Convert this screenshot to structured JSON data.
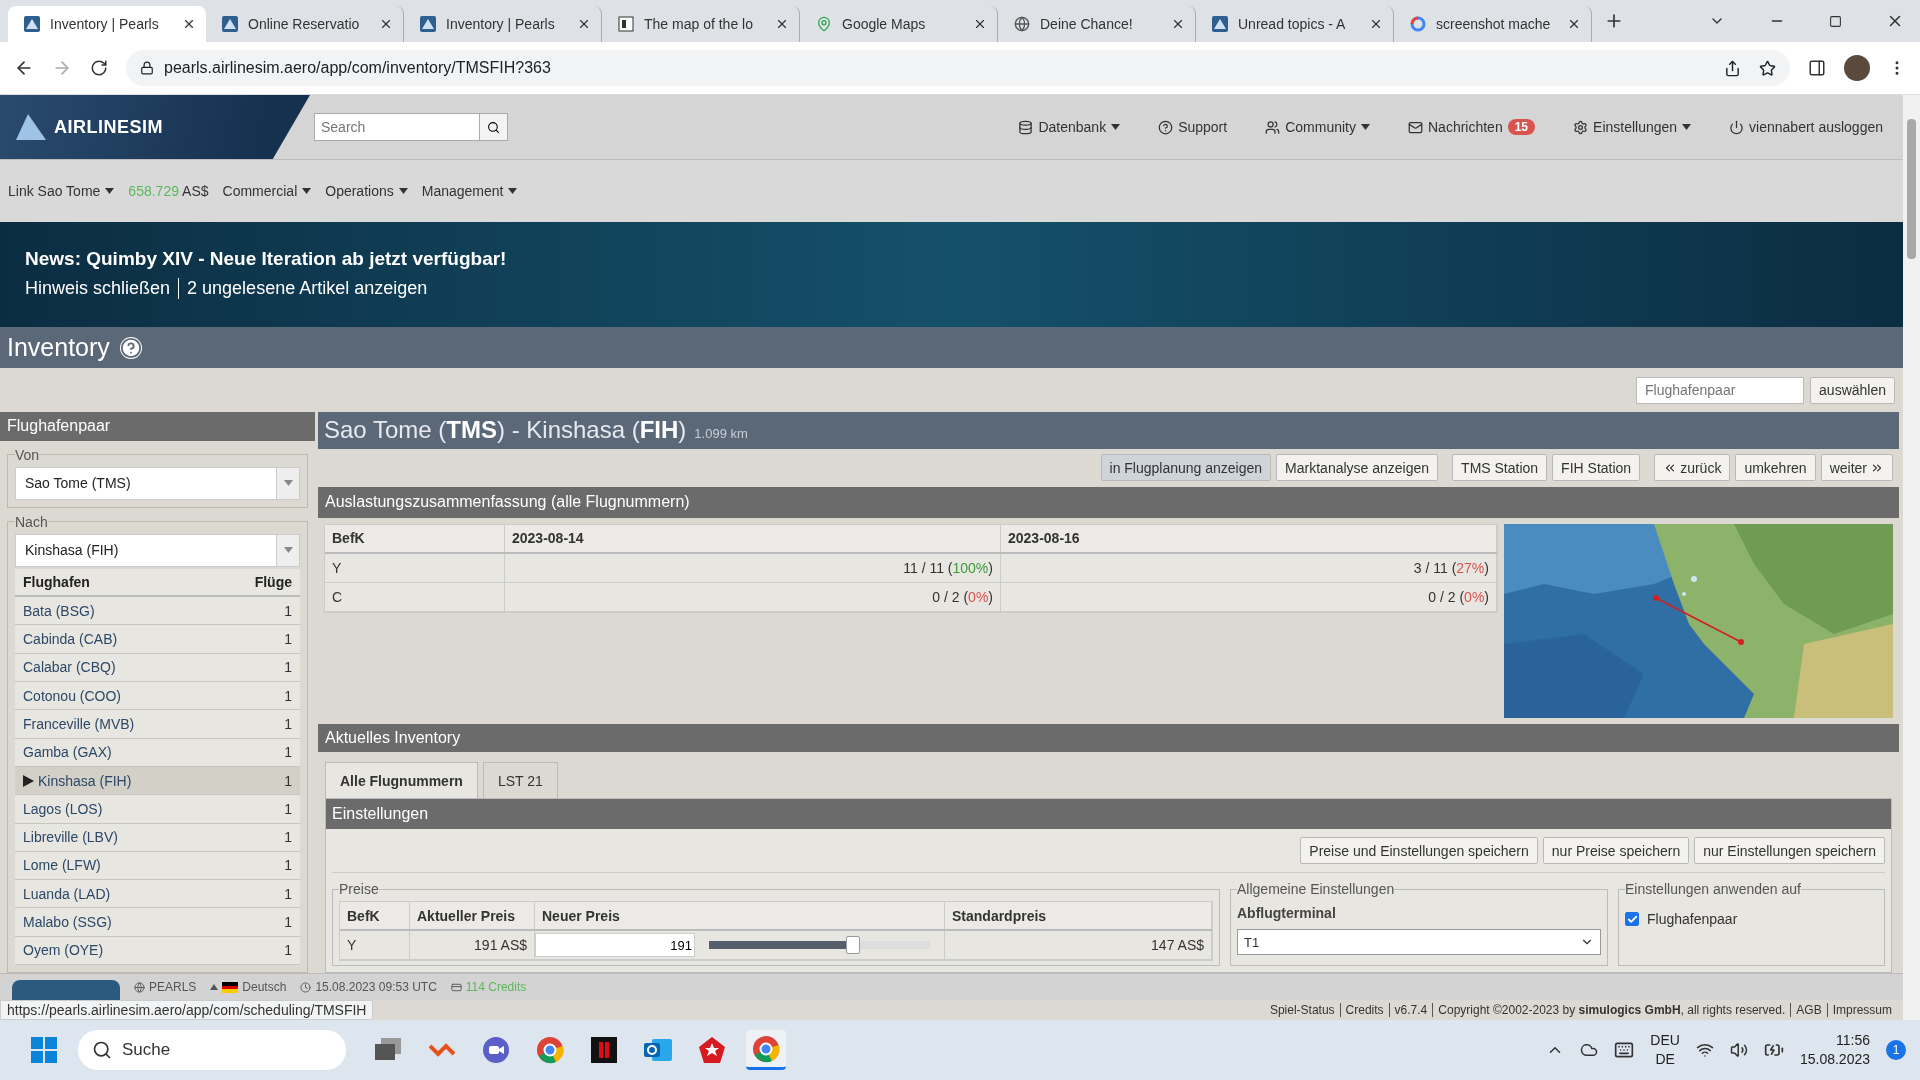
{
  "browser": {
    "tabs": [
      {
        "title": "Inventory | Pearls",
        "selected": true
      },
      {
        "title": "Online Reservatio",
        "selected": false
      },
      {
        "title": "Inventory | Pearls",
        "selected": false
      },
      {
        "title": "The map of the lo",
        "selected": false
      },
      {
        "title": "Google Maps",
        "selected": false
      },
      {
        "title": "Deine Chance!",
        "selected": false
      },
      {
        "title": "Unread topics - A",
        "selected": false
      },
      {
        "title": "screenshot mache",
        "selected": false
      }
    ],
    "address": "pearls.airlinesim.aero/app/com/inventory/TMSFIH?363"
  },
  "header": {
    "logo": "AIRLINESIM",
    "search": {
      "placeholder": "Search"
    },
    "menu": [
      {
        "label": "Datenbank",
        "kind": "dropdown"
      },
      {
        "label": "Support",
        "kind": "link"
      },
      {
        "label": "Community",
        "kind": "dropdown"
      },
      {
        "label": "Nachrichten",
        "kind": "badge",
        "badge": "15"
      },
      {
        "label": "Einstellungen",
        "kind": "dropdown"
      },
      {
        "label": "viennabert ausloggen",
        "kind": "link"
      }
    ]
  },
  "nav": [
    {
      "label": "Link Sao Tome",
      "kind": "dropdown"
    },
    {
      "label": "658.729",
      "unit": "AS$",
      "kind": "balance"
    },
    {
      "label": "Commercial",
      "kind": "dropdown"
    },
    {
      "label": "Operations",
      "kind": "dropdown"
    },
    {
      "label": "Management",
      "kind": "dropdown"
    }
  ],
  "news": {
    "title": "News: Quimby XIV - Neue Iteration ab jetzt verfügbar!",
    "links": [
      "Hinweis schließen",
      "2 ungelesene Artikel anzeigen"
    ]
  },
  "page_title": "Inventory",
  "filter": {
    "placeholder": "Flughafenpaar",
    "button": "auswählen"
  },
  "sidebar": {
    "title": "Flughafenpaar",
    "from": {
      "legend": "Von",
      "value": "Sao Tome (TMS)"
    },
    "to": {
      "legend": "Nach",
      "value": "Kinshasa (FIH)"
    },
    "columns": [
      "Flughafen",
      "Flüge"
    ],
    "rows": [
      {
        "airport": "Bata (BSG)",
        "flights": "1",
        "selected": false
      },
      {
        "airport": "Cabinda (CAB)",
        "flights": "1",
        "selected": false
      },
      {
        "airport": "Calabar (CBQ)",
        "flights": "1",
        "selected": false
      },
      {
        "airport": "Cotonou (COO)",
        "flights": "1",
        "selected": false
      },
      {
        "airport": "Franceville (MVB)",
        "flights": "1",
        "selected": false
      },
      {
        "airport": "Gamba (GAX)",
        "flights": "1",
        "selected": false
      },
      {
        "airport": "Kinshasa (FIH)",
        "flights": "1",
        "selected": true
      },
      {
        "airport": "Lagos (LOS)",
        "flights": "1",
        "selected": false
      },
      {
        "airport": "Libreville (LBV)",
        "flights": "1",
        "selected": false
      },
      {
        "airport": "Lome (LFW)",
        "flights": "1",
        "selected": false
      },
      {
        "airport": "Luanda (LAD)",
        "flights": "1",
        "selected": false
      },
      {
        "airport": "Malabo (SSG)",
        "flights": "1",
        "selected": false
      },
      {
        "airport": "Oyem (OYE)",
        "flights": "1",
        "selected": false
      }
    ]
  },
  "route": {
    "title": "Sao Tome (**TMS**) - Kinshasa (**FIH**)",
    "distance": "1.099 km",
    "actions": [
      [
        {
          "label": "in Flugplanung anzeigen",
          "kind": "plain",
          "pressed": true
        },
        {
          "label": "Marktanalyse anzeigen",
          "kind": "plain",
          "pressed": false
        }
      ],
      [
        {
          "label": "TMS Station",
          "kind": "plain",
          "pressed": false
        },
        {
          "label": "FIH Station",
          "kind": "plain",
          "pressed": false
        }
      ],
      [
        {
          "label": "zurück",
          "kind": "prev",
          "pressed": false
        },
        {
          "label": "umkehren",
          "kind": "plain",
          "pressed": false
        },
        {
          "label": "weiter",
          "kind": "next",
          "pressed": false
        }
      ]
    ]
  },
  "summary": {
    "title": "Auslastungszusammenfassung (alle Flugnummern)",
    "columns": [
      "BefK",
      "2023-08-14",
      "2023-08-16"
    ],
    "rows": [
      {
        "class": "Y",
        "cells": [
          {
            "value": "11 / 11 (",
            "pct": "100%",
            "close": ")",
            "color": "#3c9a3c"
          },
          {
            "value": "3 / 11 (",
            "pct": "27%",
            "close": ")",
            "color": "#d9534f"
          }
        ]
      },
      {
        "class": "C",
        "cells": [
          {
            "value": "0 / 2 (",
            "pct": "0%",
            "close": ")",
            "color": "#d9534f"
          },
          {
            "value": "0 / 2 (",
            "pct": "0%",
            "close": ")",
            "color": "#d9534f"
          }
        ]
      }
    ]
  },
  "inventory": {
    "title": "Aktuelles Inventory",
    "tabs": [
      {
        "label": "Alle Flugnummern",
        "selected": true
      },
      {
        "label": "LST 21",
        "selected": false
      }
    ],
    "settings": {
      "title": "Einstellungen",
      "buttons": [
        "Preise und Einstellungen speichern",
        "nur Preise speichern",
        "nur Einstellungen speichern"
      ],
      "prices": {
        "legend": "Preise",
        "columns": [
          "BefK",
          "Aktueller Preis",
          "Neuer Preis",
          "Standardpreis"
        ],
        "rows": [
          {
            "class": "Y",
            "current": "191 AS$",
            "new": "191",
            "level": 0.65,
            "standard": "147 AS$"
          }
        ]
      },
      "general": {
        "legend": "Allgemeine Einstellungen",
        "label": "Abflugterminal",
        "value": "T1"
      },
      "apply": {
        "legend": "Einstellungen anwenden auf",
        "options": [
          {
            "label": "Flughafenpaar",
            "checked": true
          }
        ]
      }
    }
  },
  "footer": {
    "server": "PEARLS",
    "language": "Deutsch",
    "time": "15.08.2023 09:53 UTC",
    "credits": "114 Credits"
  },
  "status_url": "https://pearls.airlinesim.aero/app/com/scheduling/TMSFIH",
  "copyright": {
    "links": [
      "Spiel-Status",
      "Credits"
    ],
    "version": "v6.7.4",
    "text": "Copyright ©2002-2023 by **simulogics GmbH**, all rights reserved.",
    "legal": [
      "AGB",
      "Impressum"
    ]
  },
  "taskbar": {
    "search": "Suche",
    "language": "DEU",
    "layout": "DE",
    "time": "11:56",
    "date": "15.08.2023",
    "notifications": "1"
  }
}
